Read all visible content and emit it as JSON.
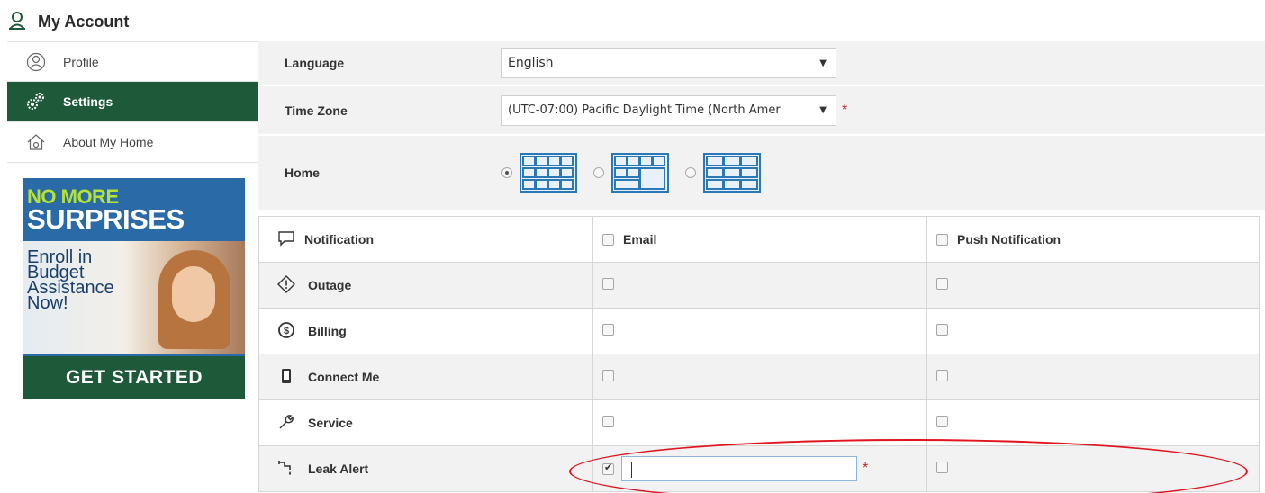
{
  "header": {
    "title": "My Account",
    "icon": "user-icon"
  },
  "sidebar": {
    "items": [
      {
        "label": "Profile",
        "icon": "profile-icon",
        "active": false
      },
      {
        "label": "Settings",
        "icon": "gears-icon",
        "active": true
      },
      {
        "label": "About My Home",
        "icon": "home-icon",
        "active": false
      }
    ]
  },
  "promo": {
    "line1": "NO MORE",
    "line2": "SURPRISES",
    "body": "Enroll in Budget Assistance Now!",
    "cta": "GET STARTED"
  },
  "settings": {
    "language": {
      "label": "Language",
      "value": "English"
    },
    "timezone": {
      "label": "Time Zone",
      "value": "(UTC-07:00) Pacific Daylight Time (North Amer",
      "required_mark": "*"
    },
    "home": {
      "label": "Home",
      "selected_layout": 0,
      "layouts": [
        "layout-4x3-icon",
        "layout-mixed-icon",
        "layout-2x3-icon"
      ]
    }
  },
  "notifications": {
    "header": {
      "label": "Notification",
      "email": "Email",
      "push": "Push Notification"
    },
    "rows": [
      {
        "label": "Outage",
        "icon": "outage-icon",
        "email": false,
        "push": false
      },
      {
        "label": "Billing",
        "icon": "billing-icon",
        "email": false,
        "push": false
      },
      {
        "label": "Connect Me",
        "icon": "phone-icon",
        "email": false,
        "push": false
      },
      {
        "label": "Service",
        "icon": "wrench-icon",
        "email": false,
        "push": false
      },
      {
        "label": "Leak Alert",
        "icon": "leak-icon",
        "email": true,
        "push": false,
        "input_value": "",
        "required_mark": "*"
      }
    ]
  },
  "colors": {
    "brand_green": "#1e5a3a",
    "accent_blue": "#2b78b6",
    "required_red": "#c0242b",
    "highlight_red": "#e0141e"
  }
}
